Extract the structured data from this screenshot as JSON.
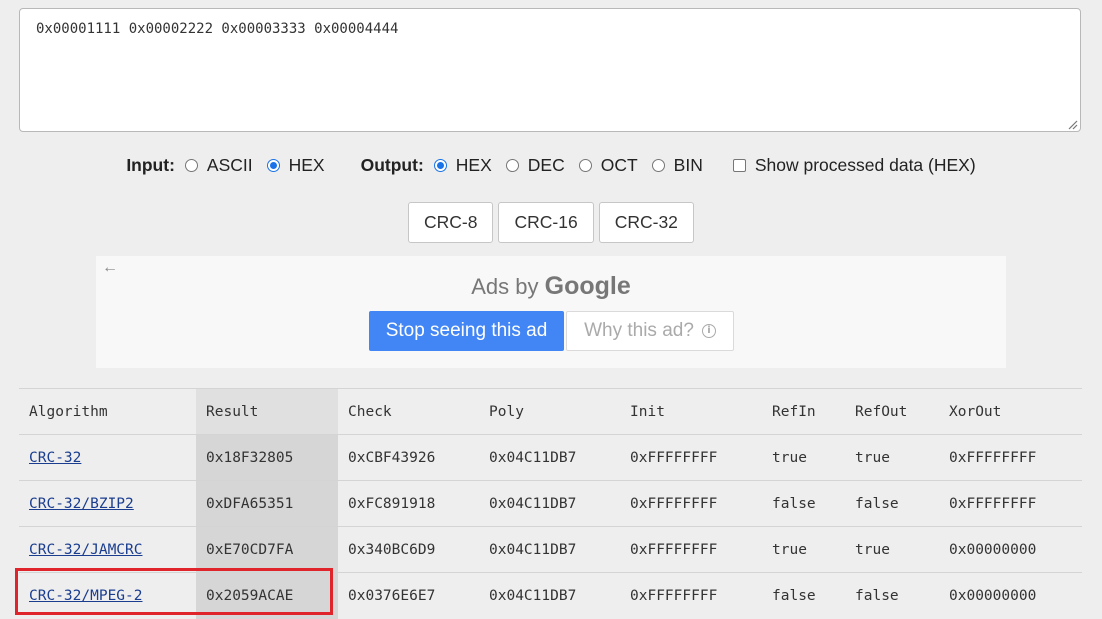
{
  "input_text": "0x00001111 0x00002222 0x00003333 0x00004444",
  "options": {
    "input_label": "Input:",
    "input_options": [
      "ASCII",
      "HEX"
    ],
    "input_selected": "HEX",
    "output_label": "Output:",
    "output_options": [
      "HEX",
      "DEC",
      "OCT",
      "BIN"
    ],
    "output_selected": "HEX",
    "show_processed_label": "Show processed data (HEX)",
    "show_processed_checked": false
  },
  "buttons": [
    "CRC-8",
    "CRC-16",
    "CRC-32"
  ],
  "ad": {
    "prefix": "Ads by ",
    "brand": "Google",
    "stop_label": "Stop seeing this ad",
    "why_label": "Why this ad?",
    "back_icon": "arrow-left-icon",
    "info_icon": "info-icon"
  },
  "table": {
    "headers": [
      "Algorithm",
      "Result",
      "Check",
      "Poly",
      "Init",
      "RefIn",
      "RefOut",
      "XorOut"
    ],
    "rows": [
      [
        "CRC-32",
        "0x18F32805",
        "0xCBF43926",
        "0x04C11DB7",
        "0xFFFFFFFF",
        "true",
        "true",
        "0xFFFFFFFF"
      ],
      [
        "CRC-32/BZIP2",
        "0xDFA65351",
        "0xFC891918",
        "0x04C11DB7",
        "0xFFFFFFFF",
        "false",
        "false",
        "0xFFFFFFFF"
      ],
      [
        "CRC-32/JAMCRC",
        "0xE70CD7FA",
        "0x340BC6D9",
        "0x04C11DB7",
        "0xFFFFFFFF",
        "true",
        "true",
        "0x00000000"
      ],
      [
        "CRC-32/MPEG-2",
        "0x2059ACAE",
        "0x0376E6E7",
        "0x04C11DB7",
        "0xFFFFFFFF",
        "false",
        "false",
        "0x00000000"
      ]
    ],
    "highlighted_row": "CRC-32/MPEG-2"
  },
  "colors": {
    "accent": "#1a73e8",
    "ad_button": "#4285f4",
    "highlight": "#e0242c",
    "link": "#1a3d8f"
  }
}
